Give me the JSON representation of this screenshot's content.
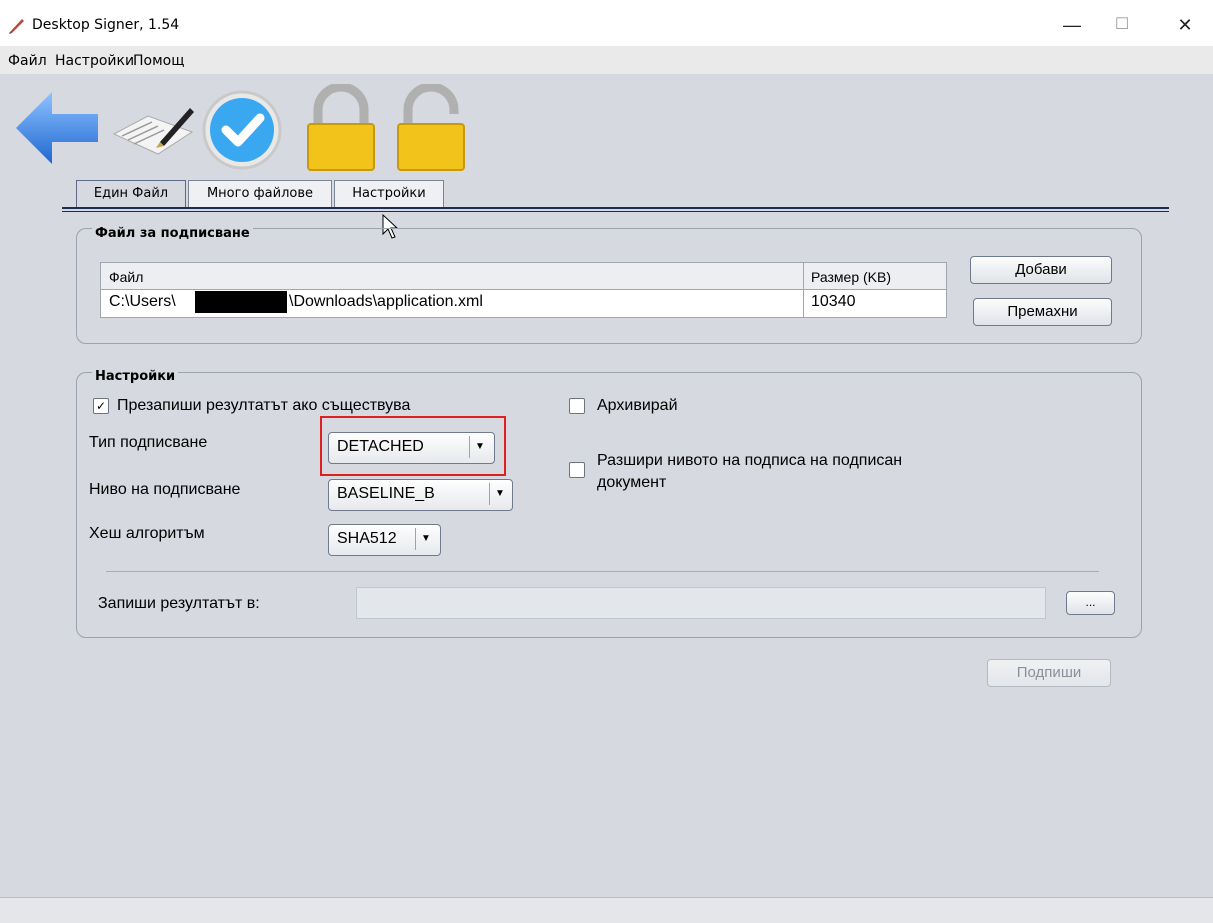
{
  "window": {
    "title": "Desktop Signer, 1.54",
    "minimize": "—",
    "maximize": "☐",
    "close": "✕"
  },
  "menu": [
    "Файл",
    "Настройки",
    "Помощ"
  ],
  "toolbar": [
    {
      "icon": "back-arrow-icon"
    },
    {
      "icon": "sign-document-icon"
    },
    {
      "icon": "verify-check-icon"
    },
    {
      "icon": "lock-closed-icon"
    },
    {
      "icon": "lock-open-icon"
    }
  ],
  "tabs": [
    "Един Файл",
    "Много файлове",
    "Настройки"
  ],
  "file_group": {
    "title": "Файл за подписване",
    "columns": [
      "Файл",
      "Размер (KB)"
    ],
    "rows": [
      {
        "file_prefix": "C:\\Users\\",
        "file_suffix": "\\Downloads\\application.xml",
        "size": "10340"
      }
    ],
    "add_button": "Добави",
    "remove_button": "Премахни"
  },
  "settings_group": {
    "title": "Настройки",
    "overwrite_label": "Презапиши резултатът ако съществува",
    "overwrite_checked": true,
    "archive_label": "Архивирай",
    "archive_checked": false,
    "extend_label_line1": "Разшири нивото на подписа на подписан",
    "extend_label_line2": "документ",
    "extend_checked": false,
    "sign_type_label": "Тип подписване",
    "sign_type_value": "DETACHED",
    "sign_level_label": "Ниво на подписване",
    "sign_level_value": "BASELINE_B",
    "hash_label": "Хеш алгоритъм",
    "hash_value": "SHA512",
    "output_label": "Запиши резултатът в:",
    "output_value": "",
    "browse_button": "..."
  },
  "sign_button": "Подпиши",
  "highlight_color": "#e02020"
}
